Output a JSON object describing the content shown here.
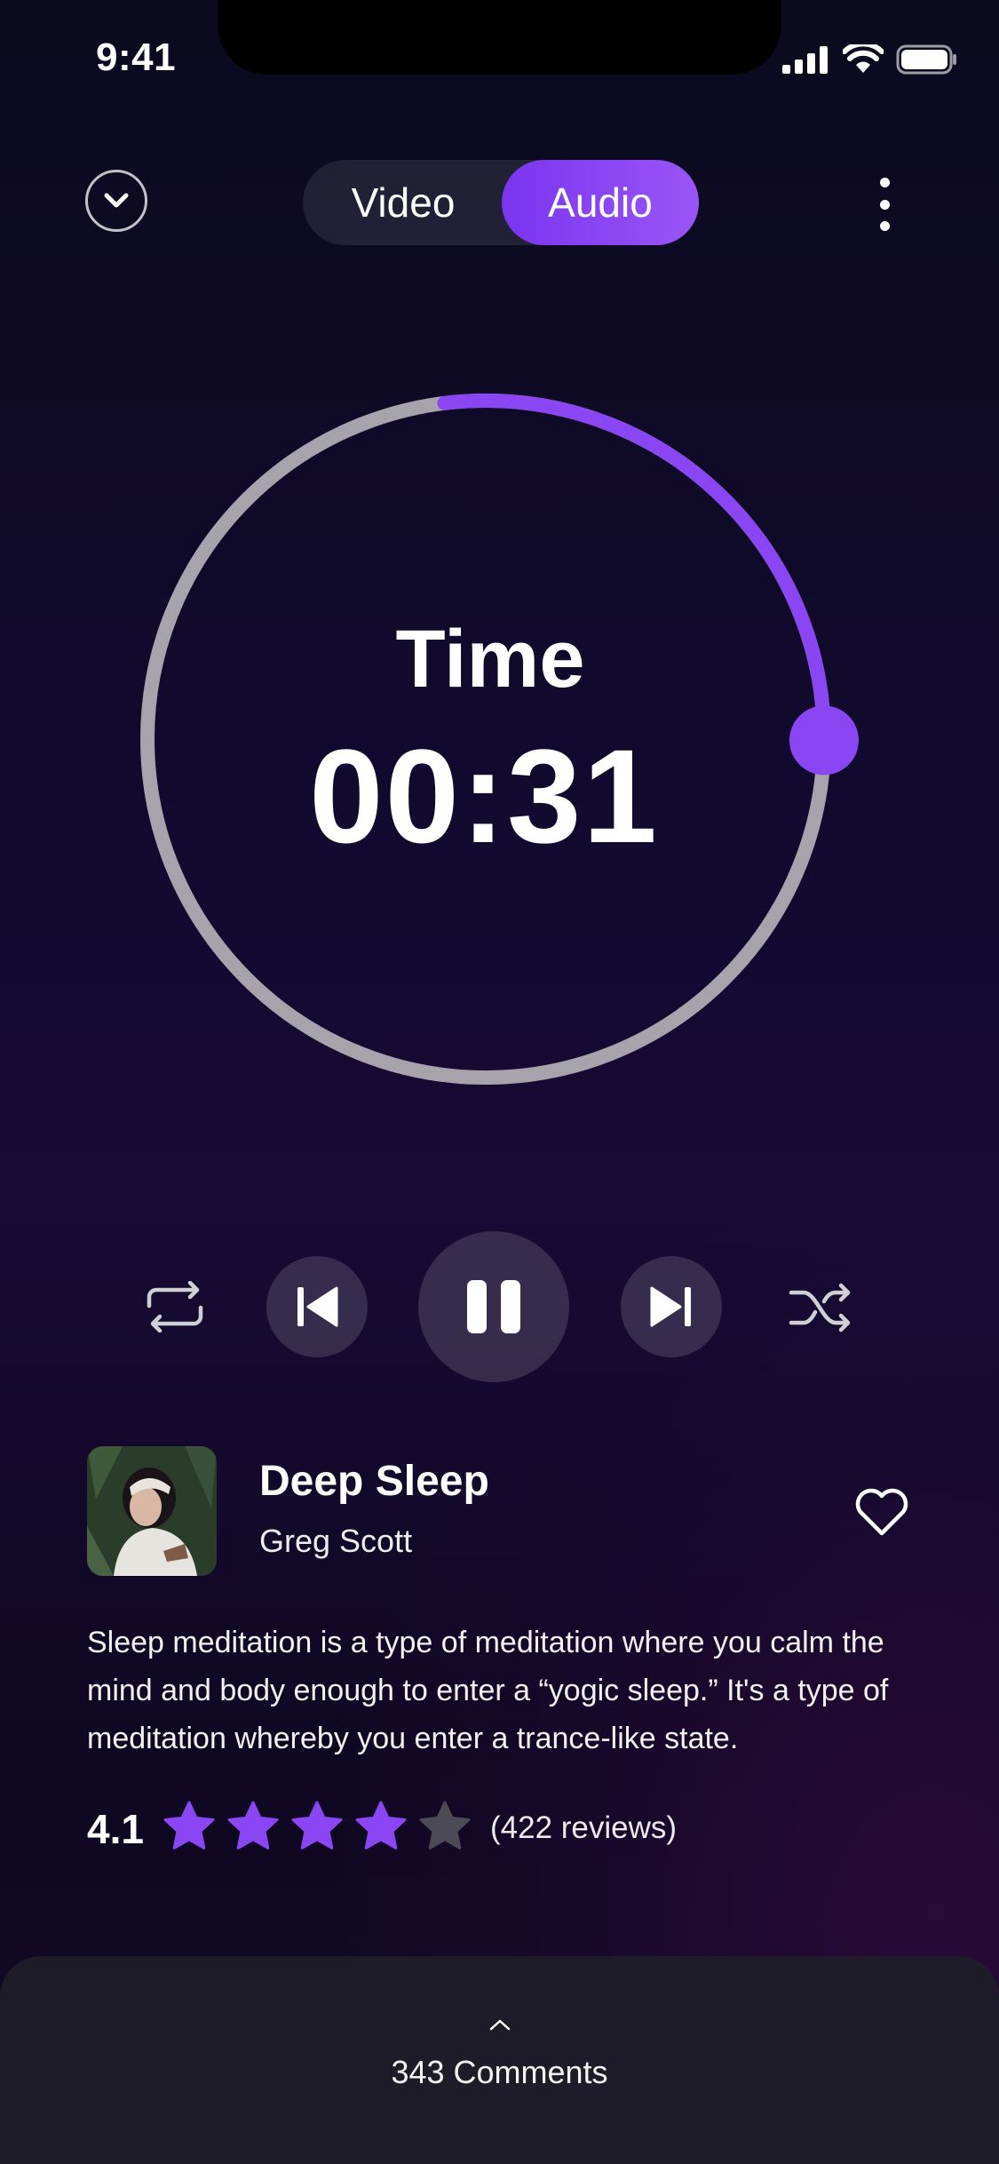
{
  "status_bar": {
    "time": "9:41"
  },
  "header": {
    "modes": {
      "video": "Video",
      "audio": "Audio",
      "active": "Audio"
    }
  },
  "timer": {
    "label": "Time",
    "value": "00:31",
    "progress": 0.27
  },
  "track": {
    "title": "Deep Sleep",
    "artist": "Greg Scott",
    "description": "Sleep meditation is a type of meditation where you calm the mind and body enough to enter a “yogic sleep.” It's a type of meditation whereby you enter a trance-like state."
  },
  "rating": {
    "value": "4.1",
    "filled_stars": 4,
    "total_stars": 5,
    "reviews": "(422 reviews)"
  },
  "comments": {
    "label": "343 Comments"
  },
  "colors": {
    "accent": "#8b46f4",
    "ring_track": "#a6a3ad",
    "star_empty": "#4b4a55"
  },
  "icons": [
    "chevron-down-icon",
    "more-vertical-icon",
    "repeat-icon",
    "previous-icon",
    "pause-icon",
    "next-icon",
    "shuffle-icon",
    "heart-icon",
    "star-icon",
    "chevron-up-icon"
  ]
}
